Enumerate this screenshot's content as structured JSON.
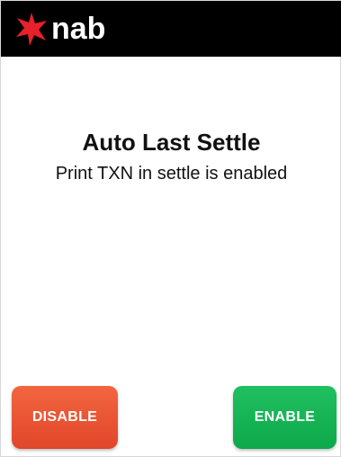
{
  "header": {
    "logo_text": "nab",
    "logo_icon": "star-icon",
    "brand_color": "#e8202a"
  },
  "main": {
    "title": "Auto Last Settle",
    "message": "Print TXN in settle is enabled"
  },
  "buttons": {
    "disable_label": "DISABLE",
    "enable_label": "ENABLE",
    "disable_color": "#e94e31",
    "enable_color": "#14b453"
  }
}
